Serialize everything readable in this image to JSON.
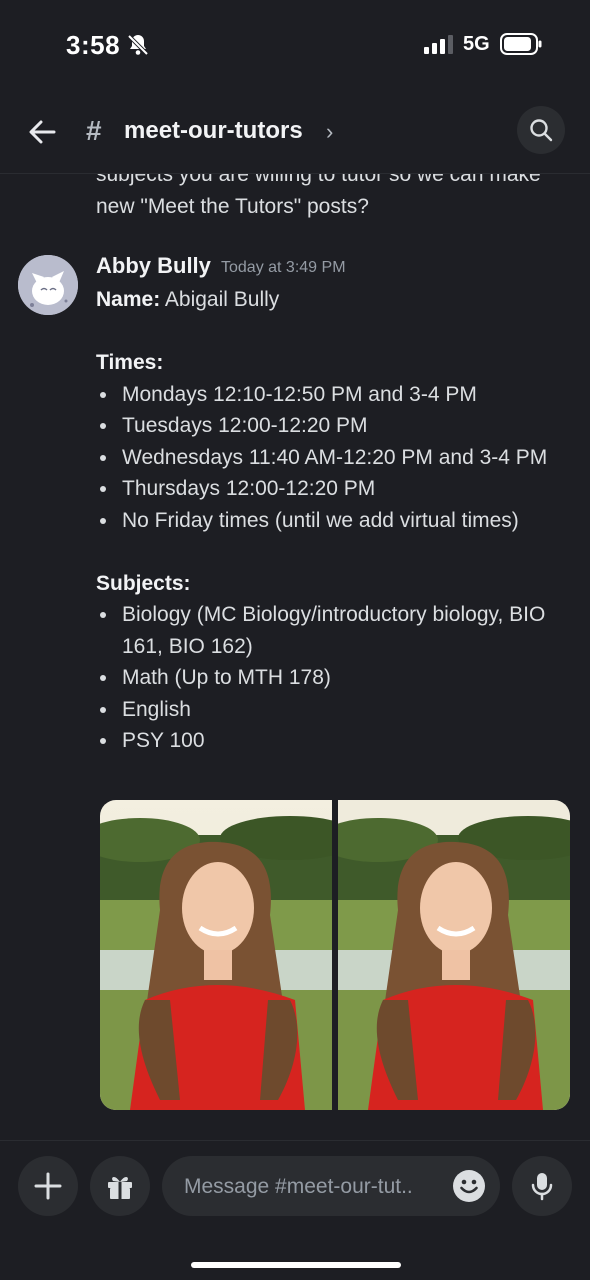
{
  "status_bar": {
    "time": "3:58",
    "network": "5G"
  },
  "header": {
    "hash": "#",
    "channel": "meet-our-tutors",
    "chevron": "›"
  },
  "previous_message": {
    "text": "subjects you are willing to tutor so we can make new \"Meet the Tutors\" posts?"
  },
  "message": {
    "author": "Abby Bully",
    "timestamp": "Today at 3:49 PM",
    "name_label": "Name:",
    "name_value": " Abigail Bully",
    "times_label": "Times:",
    "times": [
      "Mondays 12:10-12:50 PM and 3-4 PM",
      "Tuesdays 12:00-12:20 PM",
      "Wednesdays 11:40 AM-12:20 PM and 3-4 PM",
      "Thursdays 12:00-12:20 PM",
      "No Friday times (until we add virtual times)"
    ],
    "subjects_label": "Subjects:",
    "subjects": [
      "Biology (MC Biology/introductory biology, BIO 161, BIO 162)",
      "Math (Up to MTH 178)",
      "English",
      "PSY 100"
    ]
  },
  "composer": {
    "placeholder": "Message #meet-our-tut.."
  },
  "colors": {
    "background": "#1d1e23",
    "surface": "#2b2d31",
    "text": "#dbdee1",
    "muted": "#949ba4"
  },
  "icons": [
    "bell-slash-icon",
    "signal-icon",
    "battery-icon",
    "back-arrow-icon",
    "search-icon",
    "plus-icon",
    "gift-icon",
    "emoji-icon",
    "microphone-icon"
  ]
}
